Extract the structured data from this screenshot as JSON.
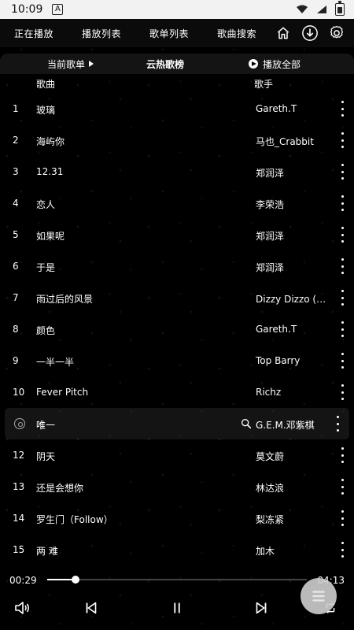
{
  "status_bar": {
    "time": "10:09",
    "alert_badge": "A"
  },
  "nav": {
    "tabs": [
      "正在播放",
      "播放列表",
      "歌单列表",
      "歌曲搜索"
    ],
    "icons": [
      "home-icon",
      "download-icon",
      "settings-icon"
    ]
  },
  "category": {
    "current_label": "当前歌单",
    "center_label": "云热歌榜",
    "play_all_label": "播放全部"
  },
  "header": {
    "song_col": "歌曲",
    "artist_col": "歌手"
  },
  "songs": [
    {
      "idx": "1",
      "title": "玻璃",
      "artist": "Gareth.T"
    },
    {
      "idx": "2",
      "title": "海屿你",
      "artist": "马也_Crabbit"
    },
    {
      "idx": "3",
      "title": "12.31",
      "artist": "郑润泽"
    },
    {
      "idx": "4",
      "title": "恋人",
      "artist": "李荣浩"
    },
    {
      "idx": "5",
      "title": "如果呢",
      "artist": "郑润泽"
    },
    {
      "idx": "6",
      "title": "于是",
      "artist": "郑润泽"
    },
    {
      "idx": "7",
      "title": "雨过后的风景",
      "artist": "Dizzy Dizzo (蔡…"
    },
    {
      "idx": "8",
      "title": "颜色",
      "artist": "Gareth.T"
    },
    {
      "idx": "9",
      "title": "一半一半",
      "artist": "Top Barry"
    },
    {
      "idx": "10",
      "title": "Fever Pitch",
      "artist": "Richz"
    },
    {
      "idx": "",
      "title": "唯一",
      "artist": "G.E.M.邓紫棋",
      "active": true
    },
    {
      "idx": "12",
      "title": "阴天",
      "artist": "莫文蔚"
    },
    {
      "idx": "13",
      "title": "还是会想你",
      "artist": "林达浪"
    },
    {
      "idx": "14",
      "title": "罗生门（Follow）",
      "artist": "梨冻紧"
    },
    {
      "idx": "15",
      "title": "两 难",
      "artist": "加木"
    }
  ],
  "player": {
    "elapsed": "00:29",
    "total": "04:13",
    "progress": 0.11
  },
  "colors": {
    "background": "#000000",
    "bar": "#141414",
    "accent": "#ffffff"
  }
}
